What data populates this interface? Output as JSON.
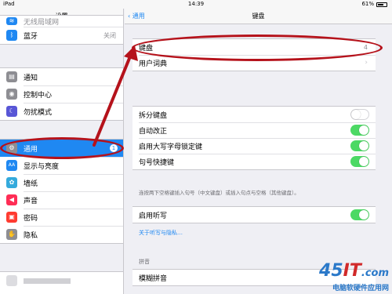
{
  "status_bar": {
    "carrier": "iPad",
    "time": "14:39",
    "battery": "61%"
  },
  "left_panel": {
    "title": "设置",
    "top_partial": "无线局域网",
    "bluetooth": {
      "label": "蓝牙",
      "value": "关闭"
    },
    "group2": [
      "通知",
      "控制中心",
      "勿扰模式"
    ],
    "general": {
      "label": "通用",
      "badge": "1"
    },
    "group3": [
      "显示与亮度",
      "墙纸",
      "声音",
      "密码",
      "隐私"
    ],
    "icon_names": {
      "wifi": "wifi-icon",
      "bluetooth": "bluetooth-icon",
      "notifications": "notifications-icon",
      "control_center": "control-center-icon",
      "dnd": "moon-icon",
      "general": "gear-icon",
      "display": "aa-icon",
      "wallpaper": "wallpaper-icon",
      "sounds": "speaker-icon",
      "passcode": "lock-icon",
      "privacy": "hand-icon"
    },
    "colors": {
      "selected": "#1f88f2"
    }
  },
  "right_panel": {
    "back_label": "通用",
    "title": "键盘",
    "keyboards": {
      "label": "键盘",
      "value": "4"
    },
    "user_dictionary": "用户词典",
    "toggles": [
      {
        "label": "拆分键盘",
        "on": false
      },
      {
        "label": "自动改正",
        "on": true
      },
      {
        "label": "启用大写字母锁定键",
        "on": true
      },
      {
        "label": "句号快捷键",
        "on": true
      }
    ],
    "shortcut_footnote": "连按两下空格键插入句号（中文键盘）或插入句点与空格（其他键盘）。",
    "dictation": {
      "label": "启用听写",
      "on": true
    },
    "dictation_link": "关于听写与隐私…",
    "pinyin_section": "拼音",
    "fuzzy_pinyin": "模糊拼音"
  },
  "watermark": {
    "logo_a": "45",
    "logo_b": "IT",
    "logo_c": ".com",
    "text": "电脑软硬件应用网"
  },
  "colors": {
    "annotation_red": "#b5121b",
    "toggle_on": "#4cd964",
    "link_blue": "#1f88f2"
  }
}
